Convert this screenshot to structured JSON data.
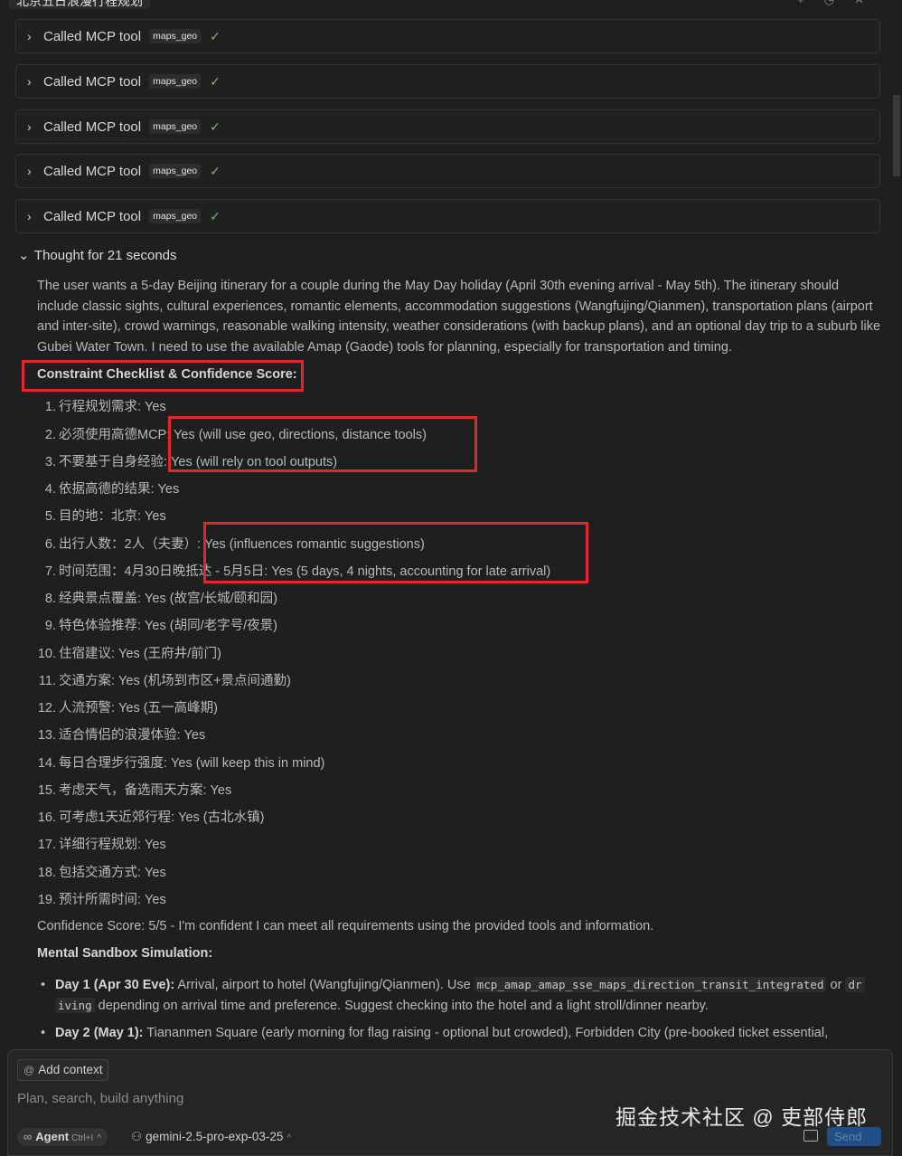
{
  "window": {
    "title": "北京五日浪漫行程规划",
    "icons": [
      "plus-icon",
      "history-icon",
      "close-icon"
    ]
  },
  "tool_calls": [
    {
      "label": "Called MCP tool",
      "tool": "maps_geo",
      "status": "check-icon"
    },
    {
      "label": "Called MCP tool",
      "tool": "maps_geo",
      "status": "check-icon"
    },
    {
      "label": "Called MCP tool",
      "tool": "maps_geo",
      "status": "check-icon"
    },
    {
      "label": "Called MCP tool",
      "tool": "maps_geo",
      "status": "check-icon"
    },
    {
      "label": "Called MCP tool",
      "tool": "maps_geo",
      "status": "check-icon"
    }
  ],
  "thought": {
    "header": "Thought for 21 seconds",
    "intro": "The user wants a 5-day Beijing itinerary for a couple during the May Day holiday (April 30th evening arrival - May 5th). The itinerary should include classic sights, cultural experiences, romantic elements, accommodation suggestions (Wangfujing/Qianmen), transportation plans (airport and inter-site), crowd warnings, reasonable walking intensity, weather considerations (with backup plans), and an optional day trip to a suburb like Gubei Water Town. I need to use the available Amap (Gaode) tools for planning, especially for transportation and timing.",
    "checklist_heading": "Constraint Checklist & Confidence Score:",
    "checklist": [
      {
        "num": "1.",
        "text": "行程规划需求: Yes"
      },
      {
        "num": "2.",
        "text": "必须使用高德MCP: Yes (will use geo, directions, distance tools)"
      },
      {
        "num": "3.",
        "text": "不要基于自身经验: Yes (will rely on tool outputs)"
      },
      {
        "num": "4.",
        "text": "依据高德的结果: Yes"
      },
      {
        "num": "5.",
        "text": "目的地：北京: Yes"
      },
      {
        "num": "6.",
        "text": "出行人数：2人（夫妻）: Yes (influences romantic suggestions)"
      },
      {
        "num": "7.",
        "text": "时间范围：4月30日晚抵达 - 5月5日: Yes (5 days, 4 nights, accounting for late arrival)"
      },
      {
        "num": "8.",
        "text": "经典景点覆盖: Yes (故宫/长城/颐和园)"
      },
      {
        "num": "9.",
        "text": "特色体验推荐: Yes (胡同/老字号/夜景)"
      },
      {
        "num": "10.",
        "text": "住宿建议: Yes (王府井/前门)"
      },
      {
        "num": "11.",
        "text": "交通方案: Yes (机场到市区+景点间通勤)"
      },
      {
        "num": "12.",
        "text": "人流预警: Yes (五一高峰期)"
      },
      {
        "num": "13.",
        "text": "适合情侣的浪漫体验: Yes"
      },
      {
        "num": "14.",
        "text": "每日合理步行强度: Yes (will keep this in mind)"
      },
      {
        "num": "15.",
        "text": "考虑天气，备选雨天方案: Yes"
      },
      {
        "num": "16.",
        "text": "可考虑1天近郊行程: Yes (古北水镇)"
      },
      {
        "num": "17.",
        "text": "详细行程规划: Yes"
      },
      {
        "num": "18.",
        "text": "包括交通方式: Yes"
      },
      {
        "num": "19.",
        "text": "预计所需时间: Yes"
      }
    ],
    "confidence": "Confidence Score: 5/5 - I'm confident I can meet all requirements using the provided tools and information.",
    "sandbox_heading": "Mental Sandbox Simulation:",
    "days": [
      {
        "title": "Day 1 (Apr 30 Eve):",
        "text1": " Arrival, airport to hotel (Wangfujing/Qianmen). Use ",
        "code1": "mcp_amap_amap_sse_maps_direction_transit_integrated",
        "text2": " or ",
        "code2a": "dr",
        "code2b": "iving",
        "text3": " depending on arrival time and preference. Suggest checking into the hotel and a light stroll/dinner nearby."
      },
      {
        "title": "Day 2 (May 1):",
        "text1": " Tiananmen Square (early morning for flag raising - optional but crowded), Forbidden City (pre-booked ticket essential,"
      }
    ]
  },
  "composer": {
    "add_context": "Add context",
    "placeholder": "Plan, search, build anything",
    "mode": "Agent",
    "mode_shortcut": "Ctrl+I",
    "model": "gemini-2.5-pro-exp-03-25",
    "send": "Send"
  },
  "watermark": "掘金技术社区 @ 吏部侍郎"
}
